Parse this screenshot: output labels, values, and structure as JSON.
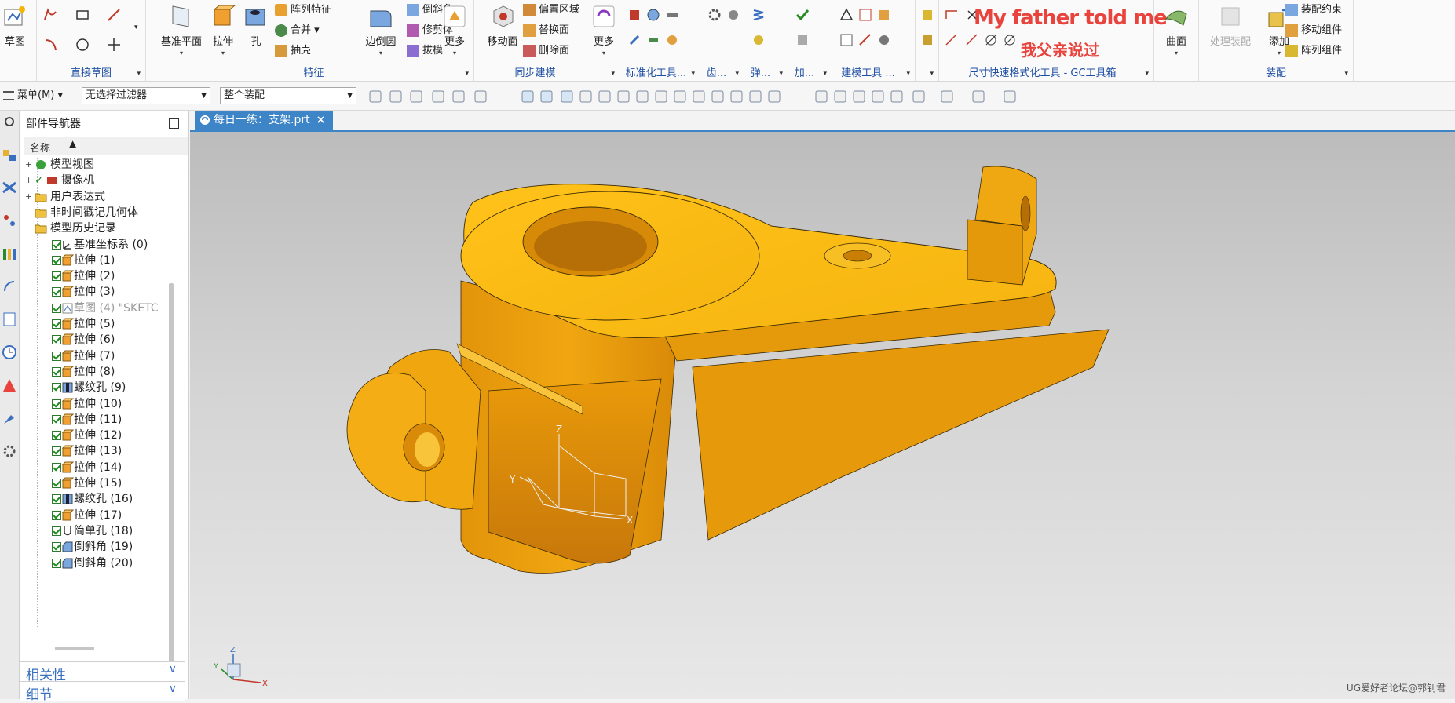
{
  "ribbon": {
    "sketch_label": "草图",
    "direct_sketch_group": "直接草图",
    "feature_group": "特征",
    "datum_plane": "基准平面",
    "extrude": "拉伸",
    "hole": "孔",
    "pattern_feature": "阵列特征",
    "unite": "合并",
    "shell": "抽壳",
    "edge_blend": "边倒圆",
    "chamfer": "倒斜角",
    "trim_body": "修剪体",
    "draft": "拔模",
    "more1": "更多",
    "sync_group": "同步建模",
    "move_face": "移动面",
    "offset_region": "偏置区域",
    "replace_face": "替换面",
    "delete_face": "删除面",
    "more2": "更多",
    "standard_tools": "标准化工具...",
    "gear": "齿...",
    "spring": "弹...",
    "add": "加...",
    "modeling_tools": "建模工具 ...",
    "dim_group": "尺寸快速格式化工具 - GC工具箱",
    "surface": "曲面",
    "process_assembly": "处理装配",
    "add_component": "添加",
    "assembly_constraint": "装配约束",
    "move_component": "移动组件",
    "pattern_component": "阵列组件",
    "assembly_group": "装配",
    "watermark_en": "My father told me",
    "watermark_cn": "我父亲说过"
  },
  "toolbar": {
    "menu": "菜单(M)",
    "filter": "无选择过滤器",
    "scope": "整个装配"
  },
  "navigator": {
    "title": "部件导航器",
    "column_name": "名称",
    "items": [
      {
        "label": "模型视图",
        "type": "folder-view"
      },
      {
        "label": "摄像机",
        "type": "camera"
      },
      {
        "label": "用户表达式",
        "type": "folder"
      },
      {
        "label": "非时间戳记几何体",
        "type": "folder"
      },
      {
        "label": "模型历史记录",
        "type": "folder-open"
      },
      {
        "label": "基准坐标系 (0)",
        "type": "datum"
      },
      {
        "label": "拉伸 (1)",
        "type": "extrude"
      },
      {
        "label": "拉伸 (2)",
        "type": "extrude"
      },
      {
        "label": "拉伸 (3)",
        "type": "extrude"
      },
      {
        "label": "草图 (4) \"SKETC",
        "type": "sketch"
      },
      {
        "label": "拉伸 (5)",
        "type": "extrude"
      },
      {
        "label": "拉伸 (6)",
        "type": "extrude"
      },
      {
        "label": "拉伸 (7)",
        "type": "extrude"
      },
      {
        "label": "拉伸 (8)",
        "type": "extrude"
      },
      {
        "label": "螺纹孔 (9)",
        "type": "hole"
      },
      {
        "label": "拉伸 (10)",
        "type": "extrude"
      },
      {
        "label": "拉伸 (11)",
        "type": "extrude"
      },
      {
        "label": "拉伸 (12)",
        "type": "extrude"
      },
      {
        "label": "拉伸 (13)",
        "type": "extrude"
      },
      {
        "label": "拉伸 (14)",
        "type": "extrude"
      },
      {
        "label": "拉伸 (15)",
        "type": "extrude"
      },
      {
        "label": "螺纹孔 (16)",
        "type": "hole"
      },
      {
        "label": "拉伸 (17)",
        "type": "extrude"
      },
      {
        "label": "简单孔 (18)",
        "type": "simple-hole"
      },
      {
        "label": "倒斜角 (19)",
        "type": "chamfer"
      },
      {
        "label": "倒斜角 (20)",
        "type": "chamfer"
      }
    ],
    "section_dependencies": "相关性",
    "section_details": "细节"
  },
  "document": {
    "tab_title": "每日一练：支架.prt"
  },
  "viewport": {
    "axis_x": "X",
    "axis_y": "Y",
    "axis_z": "Z",
    "triad_x": "X",
    "triad_y": "Y",
    "triad_z": "Z",
    "footer": "UG爱好者论坛@郭钊君"
  },
  "colors": {
    "part": "#f5b212",
    "accent": "#3d85c6",
    "link": "#1f4fa3"
  }
}
